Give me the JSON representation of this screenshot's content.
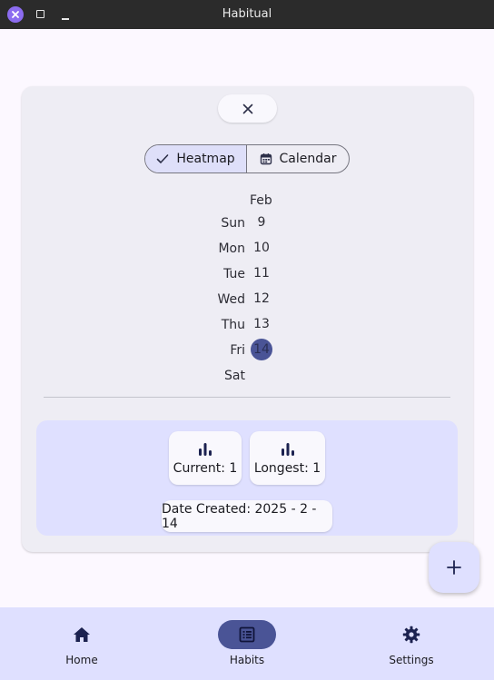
{
  "window": {
    "title": "Habitual"
  },
  "segmented": {
    "heatmap_label": "Heatmap",
    "calendar_label": "Calendar",
    "selected": "Heatmap"
  },
  "heatmap": {
    "month": "Feb",
    "days": [
      "Sun",
      "Mon",
      "Tue",
      "Wed",
      "Thu",
      "Fri",
      "Sat"
    ],
    "dates": [
      "9",
      "10",
      "11",
      "12",
      "13",
      "14"
    ],
    "completed_date": "14"
  },
  "stats": {
    "current": "Current: 1",
    "longest": "Longest: 1",
    "date_created": "Date Created: 2025 - 2 - 14"
  },
  "nav": {
    "items": [
      {
        "label": "Home",
        "icon": "home-icon"
      },
      {
        "label": "Habits",
        "icon": "list-icon"
      },
      {
        "label": "Settings",
        "icon": "gear-icon"
      }
    ],
    "active": "Habits"
  },
  "colors": {
    "accent": "#4a5496",
    "container": "#dfe0ff",
    "surface": "#eeedf4"
  }
}
